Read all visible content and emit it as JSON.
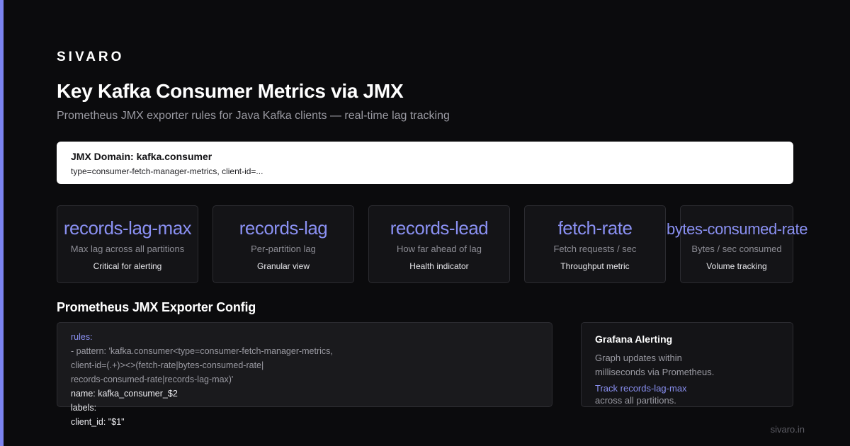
{
  "brand": "SIVARO",
  "title": "Key Kafka Consumer Metrics via JMX",
  "subtitle": "Prometheus JMX exporter rules for Java Kafka clients — real-time lag tracking",
  "domain": {
    "label": "JMX Domain: kafka.consumer",
    "value": "type=consumer-fetch-manager-metrics, client-id=..."
  },
  "metrics": [
    {
      "name": "records-lag-max",
      "desc": "Max lag across all partitions",
      "note": "Critical for alerting"
    },
    {
      "name": "records-lag",
      "desc": "Per-partition lag",
      "note": "Granular view"
    },
    {
      "name": "records-lead",
      "desc": "How far ahead of lag",
      "note": "Health indicator"
    },
    {
      "name": "fetch-rate",
      "desc": "Fetch requests / sec",
      "note": "Throughput metric"
    },
    {
      "name": "bytes-consumed-rate",
      "desc": "Bytes / sec consumed",
      "note": "Volume tracking"
    }
  ],
  "config": {
    "title": "Prometheus JMX Exporter Config",
    "lines": [
      "rules:",
      "- pattern: 'kafka.consumer<type=consumer-fetch-manager-metrics,",
      "client-id=(.+)><>(fetch-rate|bytes-consumed-rate|",
      "records-consumed-rate|records-lag-max)'",
      "name: kafka_consumer_$2",
      "labels:",
      "client_id: \"$1\""
    ]
  },
  "alerting": {
    "title": "Grafana Alerting",
    "body_1": "Graph updates within",
    "body_2": "milliseconds via Prometheus.",
    "link": "Track records-lag-max",
    "foot": "across all partitions."
  },
  "footer": "sivaro.in",
  "colors": {
    "accent": "#7b83f0",
    "background": "#0b0b0d",
    "card": "#141417"
  }
}
